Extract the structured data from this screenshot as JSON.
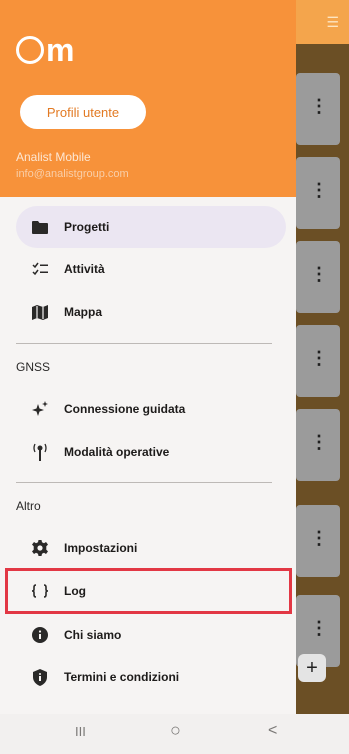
{
  "app": {
    "logo_text": "m",
    "profile_button": "Profili utente",
    "user_name": "Analist Mobile",
    "user_email": "info@analistgroup.com"
  },
  "menu": {
    "main": [
      {
        "label": "Progetti",
        "icon": "folder-icon",
        "active": true
      },
      {
        "label": "Attività",
        "icon": "checklist-icon"
      },
      {
        "label": "Mappa",
        "icon": "map-icon"
      }
    ],
    "gnss_section": "GNSS",
    "gnss": [
      {
        "label": "Connessione guidata",
        "icon": "sparkle-icon"
      },
      {
        "label": "Modalità operative",
        "icon": "antenna-icon"
      }
    ],
    "altro_section": "Altro",
    "altro": [
      {
        "label": "Impostazioni",
        "icon": "gear-icon"
      },
      {
        "label": "Log",
        "icon": "code-braces-icon",
        "highlighted": true
      },
      {
        "label": "Chi siamo",
        "icon": "info-icon"
      },
      {
        "label": "Termini e condizioni",
        "icon": "shield-icon"
      }
    ]
  },
  "background": {
    "fab_symbol": "+",
    "card_menu_symbol": "⋮"
  },
  "navbar": {
    "recents": "III",
    "home": "○",
    "back": "<"
  },
  "colors": {
    "header": "#f7923a",
    "drawer": "#f6f4f3",
    "active_item": "#ebe6f2",
    "highlight_border": "#e23744"
  }
}
